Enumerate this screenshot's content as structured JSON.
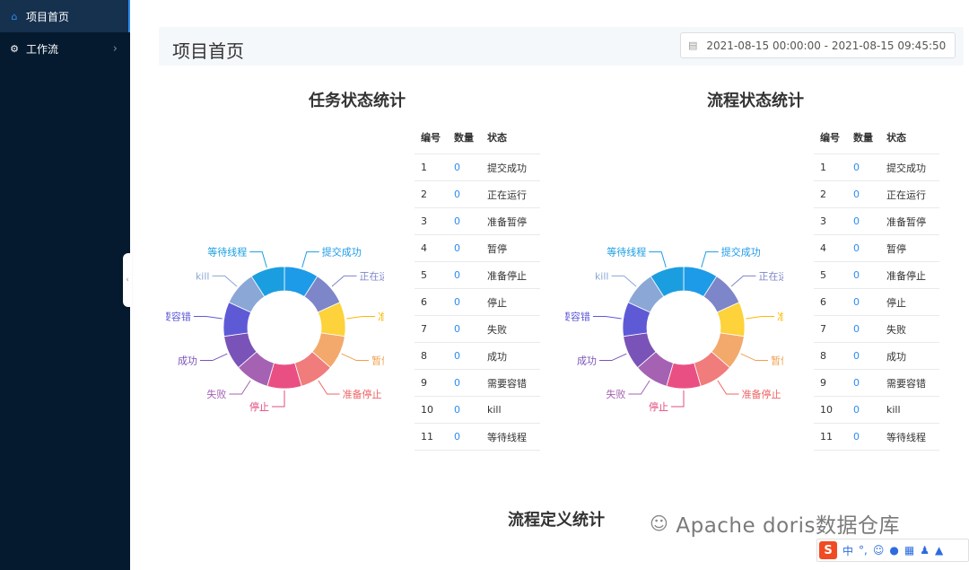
{
  "sidebar": {
    "items": [
      {
        "label": "项目首页",
        "icon": "home-icon",
        "active": true
      },
      {
        "label": "工作流",
        "icon": "gear-icon",
        "active": false
      }
    ]
  },
  "header": {
    "title": "项目首页",
    "date_range": "2021-08-15 00:00:00 - 2021-08-15 09:45:50"
  },
  "sections": {
    "task_title": "任务状态统计",
    "process_title": "流程状态统计",
    "definition_title": "流程定义统计"
  },
  "table_headers": [
    "编号",
    "数量",
    "状态"
  ],
  "task_rows": [
    [
      "1",
      "0",
      "提交成功"
    ],
    [
      "2",
      "0",
      "正在运行"
    ],
    [
      "3",
      "0",
      "准备暂停"
    ],
    [
      "4",
      "0",
      "暂停"
    ],
    [
      "5",
      "0",
      "准备停止"
    ],
    [
      "6",
      "0",
      "停止"
    ],
    [
      "7",
      "0",
      "失败"
    ],
    [
      "8",
      "0",
      "成功"
    ],
    [
      "9",
      "0",
      "需要容错"
    ],
    [
      "10",
      "0",
      "kill"
    ],
    [
      "11",
      "0",
      "等待线程"
    ]
  ],
  "process_rows": [
    [
      "1",
      "0",
      "提交成功"
    ],
    [
      "2",
      "0",
      "正在运行"
    ],
    [
      "3",
      "0",
      "准备暂停"
    ],
    [
      "4",
      "0",
      "暂停"
    ],
    [
      "5",
      "0",
      "准备停止"
    ],
    [
      "6",
      "0",
      "停止"
    ],
    [
      "7",
      "0",
      "失败"
    ],
    [
      "8",
      "0",
      "成功"
    ],
    [
      "9",
      "0",
      "需要容错"
    ],
    [
      "10",
      "0",
      "kill"
    ],
    [
      "11",
      "0",
      "等待线程"
    ]
  ],
  "chart_data": [
    {
      "type": "pie",
      "categories": [
        "提交成功",
        "正在运行",
        "准备暂停",
        "暂停",
        "准备停止",
        "停止",
        "失败",
        "成功",
        "需要容错",
        "kill",
        "等待线程"
      ],
      "values": [
        0,
        0,
        0,
        0,
        0,
        0,
        0,
        0,
        0,
        0,
        0
      ],
      "legend": "none",
      "colors": [
        "#1e9be8",
        "#7d86c8",
        "#fdd23a",
        "#f3a96b",
        "#f07c7c",
        "#ea4f84",
        "#a562b3",
        "#7a53b8",
        "#5e5ad6",
        "#8aa7d6",
        "#1a9ee0"
      ],
      "label_colors": [
        "#1e9be8",
        "#7d86c8",
        "#fdb900",
        "#f0a050",
        "#f06565",
        "#e14c80",
        "#a562b3",
        "#7a53b8",
        "#5e5ad6",
        "#8aa7d6",
        "#1a9ee0"
      ]
    },
    {
      "type": "pie",
      "categories": [
        "提交成功",
        "正在运行",
        "准备暂停",
        "暂停",
        "准备停止",
        "停止",
        "失败",
        "成功",
        "需要容错",
        "kill",
        "等待线程"
      ],
      "values": [
        0,
        0,
        0,
        0,
        0,
        0,
        0,
        0,
        0,
        0,
        0
      ],
      "legend": "none",
      "colors": [
        "#1e9be8",
        "#7d86c8",
        "#fdd23a",
        "#f3a96b",
        "#f07c7c",
        "#ea4f84",
        "#a562b3",
        "#7a53b8",
        "#5e5ad6",
        "#8aa7d6",
        "#1a9ee0"
      ],
      "label_colors": [
        "#1e9be8",
        "#7d86c8",
        "#fdb900",
        "#f0a050",
        "#f06565",
        "#e14c80",
        "#a562b3",
        "#7a53b8",
        "#5e5ad6",
        "#8aa7d6",
        "#1a9ee0"
      ]
    }
  ],
  "watermark": "Apache doris数据仓库",
  "ime": {
    "lang": "中",
    "punct": "°,"
  }
}
